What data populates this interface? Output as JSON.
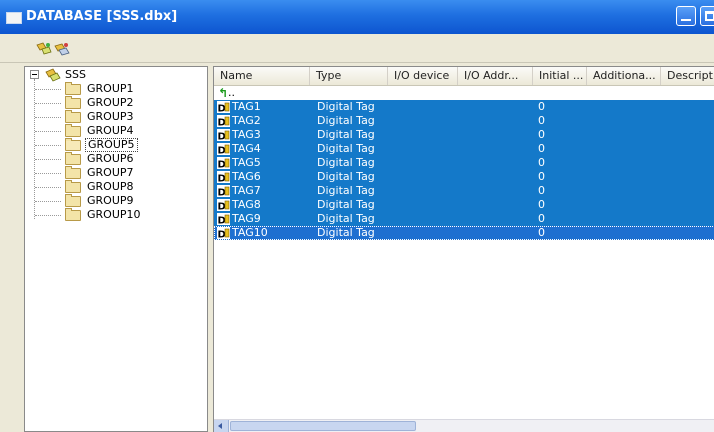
{
  "window": {
    "title": "DATABASE [SSS.dbx]"
  },
  "tree": {
    "root": "SSS",
    "groups": [
      {
        "label": "GROUP1"
      },
      {
        "label": "GROUP2"
      },
      {
        "label": "GROUP3"
      },
      {
        "label": "GROUP4"
      },
      {
        "label": "GROUP5",
        "selected": true
      },
      {
        "label": "GROUP6"
      },
      {
        "label": "GROUP7"
      },
      {
        "label": "GROUP8"
      },
      {
        "label": "GROUP9"
      },
      {
        "label": "GROUP10"
      }
    ]
  },
  "list": {
    "columns": [
      "Name",
      "Type",
      "I/O device",
      "I/O Addr...",
      "Initial ...",
      "Additiona...",
      "Descript"
    ],
    "up_label": "..",
    "rows": [
      {
        "name": "TAG1",
        "type": "Digital Tag",
        "initial": "0"
      },
      {
        "name": "TAG2",
        "type": "Digital Tag",
        "initial": "0"
      },
      {
        "name": "TAG3",
        "type": "Digital Tag",
        "initial": "0"
      },
      {
        "name": "TAG4",
        "type": "Digital Tag",
        "initial": "0"
      },
      {
        "name": "TAG5",
        "type": "Digital Tag",
        "initial": "0"
      },
      {
        "name": "TAG6",
        "type": "Digital Tag",
        "initial": "0"
      },
      {
        "name": "TAG7",
        "type": "Digital Tag",
        "initial": "0"
      },
      {
        "name": "TAG8",
        "type": "Digital Tag",
        "initial": "0"
      },
      {
        "name": "TAG9",
        "type": "Digital Tag",
        "initial": "0"
      },
      {
        "name": "TAG10",
        "type": "Digital Tag",
        "initial": "0"
      }
    ]
  },
  "colors": {
    "titlebar": "#1e6fe0",
    "selection": "#1479c9",
    "chrome": "#ece9d8"
  },
  "icons": [
    "window-icon",
    "minimize-icon",
    "maximize-icon",
    "database-add-icon",
    "database-edit-icon",
    "database-icon",
    "folder-icon",
    "folder-open-icon",
    "up-arrow-icon",
    "digital-tag-icon"
  ]
}
